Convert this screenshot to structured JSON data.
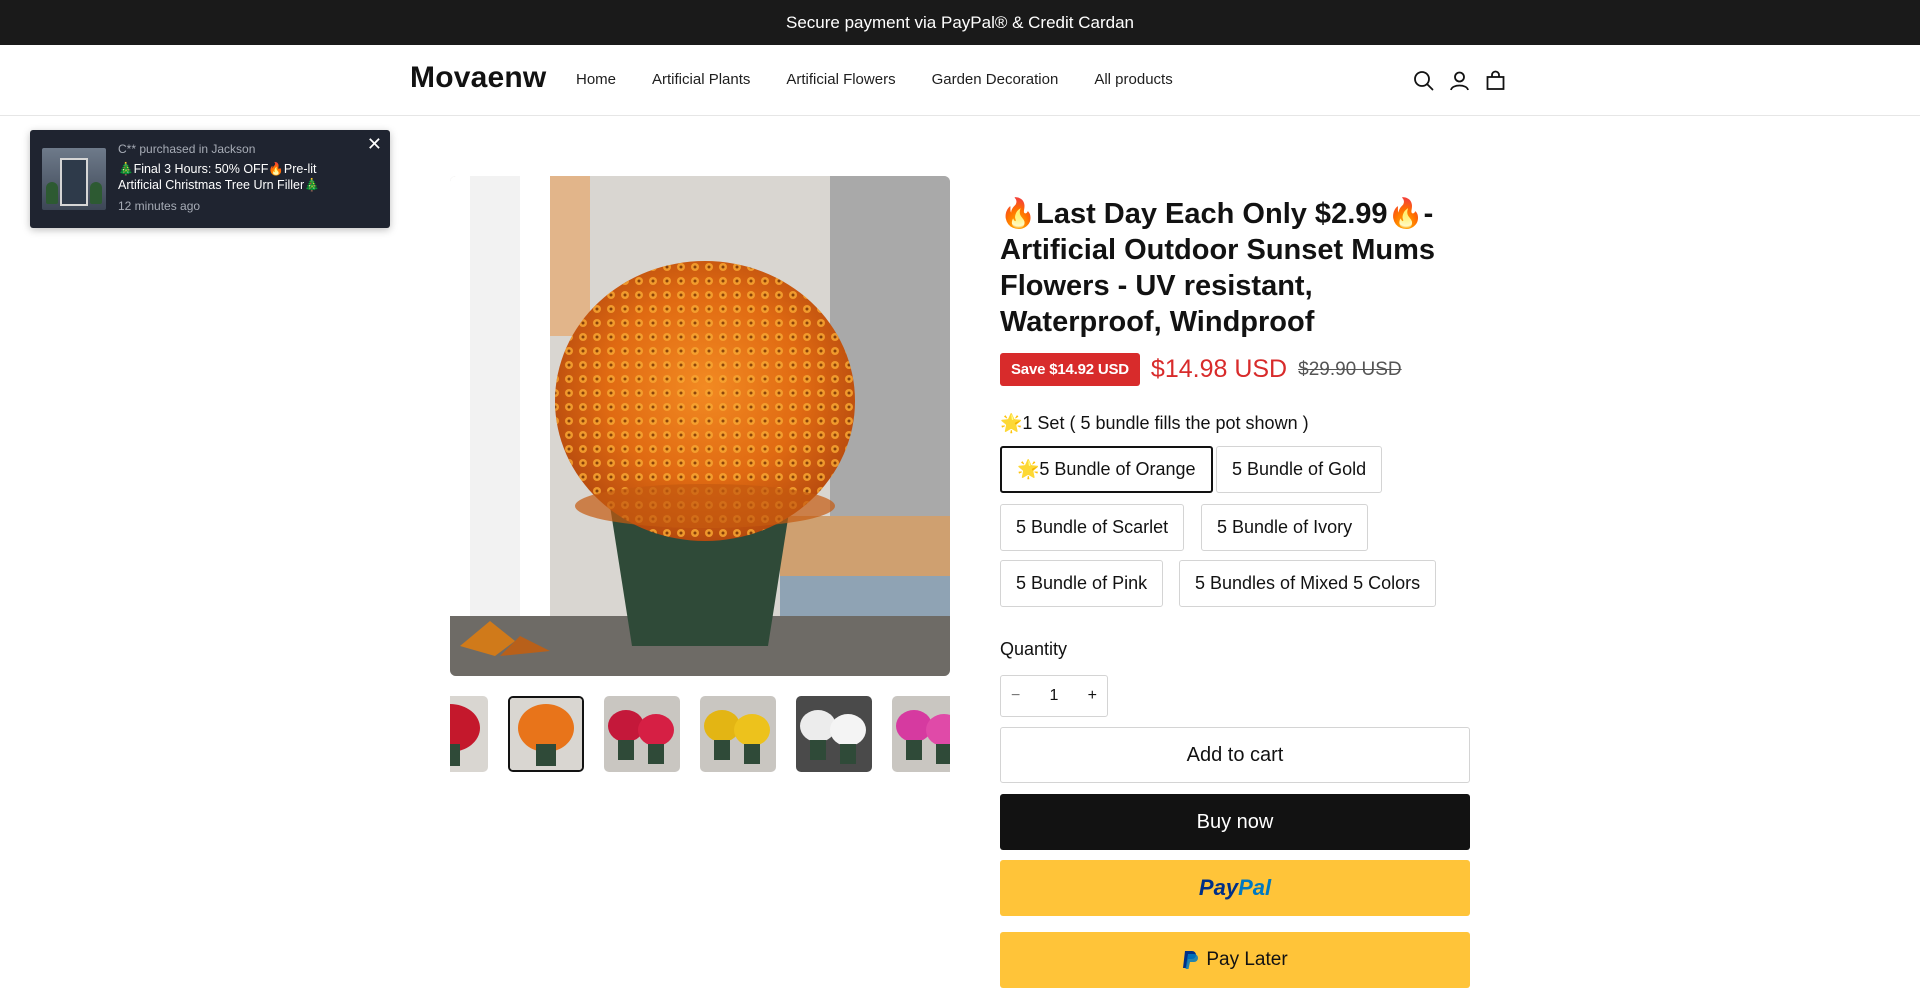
{
  "announcement": "Secure payment via PayPal® & Credit Cardan",
  "header": {
    "logo": "Movaenw",
    "nav": [
      "Home",
      "Artificial Plants",
      "Artificial Flowers",
      "Garden Decoration",
      "All products"
    ],
    "icons": [
      "search-icon",
      "account-icon",
      "cart-icon"
    ]
  },
  "toast": {
    "line1": "C** purchased in Jackson",
    "line2": "🎄Final 3 Hours: 50% OFF🔥Pre-lit Artificial Christmas Tree Urn Filler🎄",
    "line3": "12 minutes ago",
    "close": "✕"
  },
  "product": {
    "title": "🔥Last Day Each Only $2.99🔥-Artificial Outdoor Sunset Mums Flowers - UV resistant, Waterproof, Windproof",
    "save_badge": "Save $14.92 USD",
    "price": "$14.98 USD",
    "compare_price": "$29.90 USD",
    "option_label": "🌟1 Set ( 5 bundle fills the pot shown )",
    "options": [
      "🌟5 Bundle of Orange",
      "5 Bundle of Gold",
      "5 Bundle of Scarlet",
      "5 Bundle of Ivory",
      "5 Bundle of Pink",
      "5 Bundles of Mixed 5 Colors"
    ],
    "selected_option": "🌟5 Bundle of Orange",
    "quantity_label": "Quantity",
    "quantity": "1",
    "minus": "−",
    "plus": "+",
    "add_to_cart": "Add to cart",
    "buy_now": "Buy now",
    "paypal_part1": "Pay",
    "paypal_part2": "Pal",
    "pay_later": "Pay Later"
  },
  "colors": {
    "sale_red": "#d82b2b",
    "paypal_yellow": "#ffc439",
    "dark": "#121212"
  }
}
